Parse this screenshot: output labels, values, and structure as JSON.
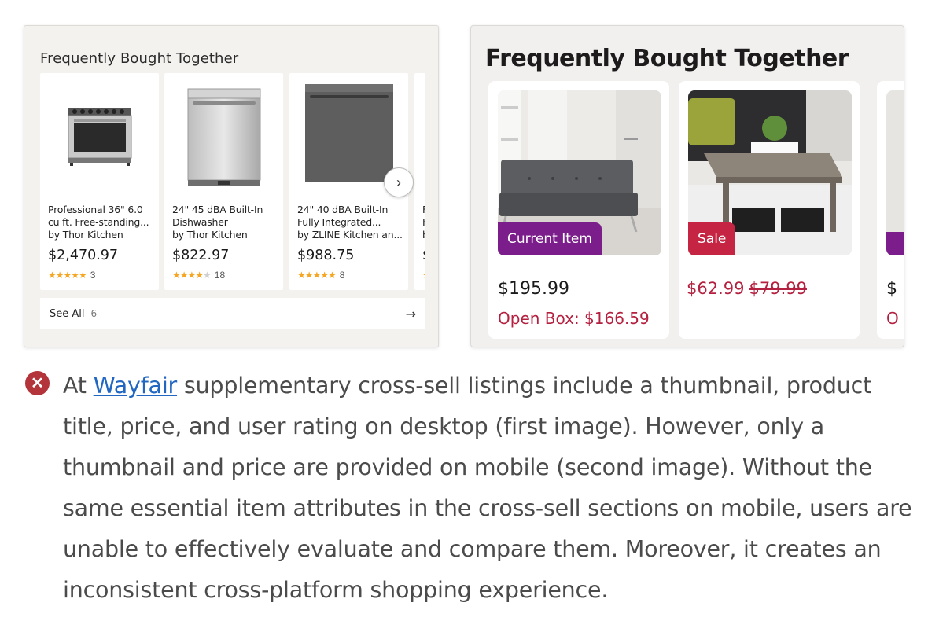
{
  "desktop": {
    "title": "Frequently Bought Together",
    "products": [
      {
        "title_lines": [
          "Professional 36\" 6.0",
          "cu ft. Free-standing...",
          "by Thor Kitchen"
        ],
        "price": "$2,470.97",
        "stars": 5,
        "rating_count": "3",
        "thumb": "range-oven"
      },
      {
        "title_lines": [
          "24\" 45 dBA Built-In",
          "Dishwasher",
          "by Thor Kitchen"
        ],
        "price": "$822.97",
        "stars": 4,
        "rating_count": "18",
        "thumb": "dishwasher-steel"
      },
      {
        "title_lines": [
          "24\" 40 dBA Built-In",
          "Fully Integrated...",
          "by ZLINE Kitchen an..."
        ],
        "price": "$988.75",
        "stars": 5,
        "rating_count": "8",
        "thumb": "dishwasher-panel"
      },
      {
        "title_lines": [
          "F",
          "F",
          "b"
        ],
        "price": "$",
        "stars": 1,
        "rating_count": "",
        "thumb": "partial"
      }
    ],
    "see_all_label": "See All",
    "see_all_count": "6",
    "next_icon": "chevron-right-icon",
    "arrow_icon": "arrow-right-icon"
  },
  "mobile": {
    "title": "Frequently Bought Together",
    "cards": [
      {
        "badge": "Current Item",
        "price": "$195.99",
        "sub": "Open Box: $166.59",
        "thumb": "futon-sofa"
      },
      {
        "badge": "Sale",
        "sale_price": "$62.99",
        "was_price": "$79.99",
        "thumb": "coffee-table"
      },
      {
        "price": "$",
        "sub": "O",
        "thumb": "partial"
      }
    ]
  },
  "caption": {
    "prefix": "At ",
    "link": "Wayfair",
    "text": " supplementary cross-sell listings include a thumbnail, product title, price, and user rating on desktop (first image). However, only a thumbnail and price are provided on mobile (second image). Without the same essential item attributes in the cross-sell sections on mobile, users are unable to effectively evaluate and compare them. Moreover, it creates an inconsistent cross-platform shopping experience.",
    "icon": "x-circle-icon"
  },
  "colors": {
    "badge_current": "#7b1d8a",
    "badge_sale": "#c52543",
    "price_red": "#b4203f",
    "link": "#2167c2",
    "star": "#f5a623"
  }
}
